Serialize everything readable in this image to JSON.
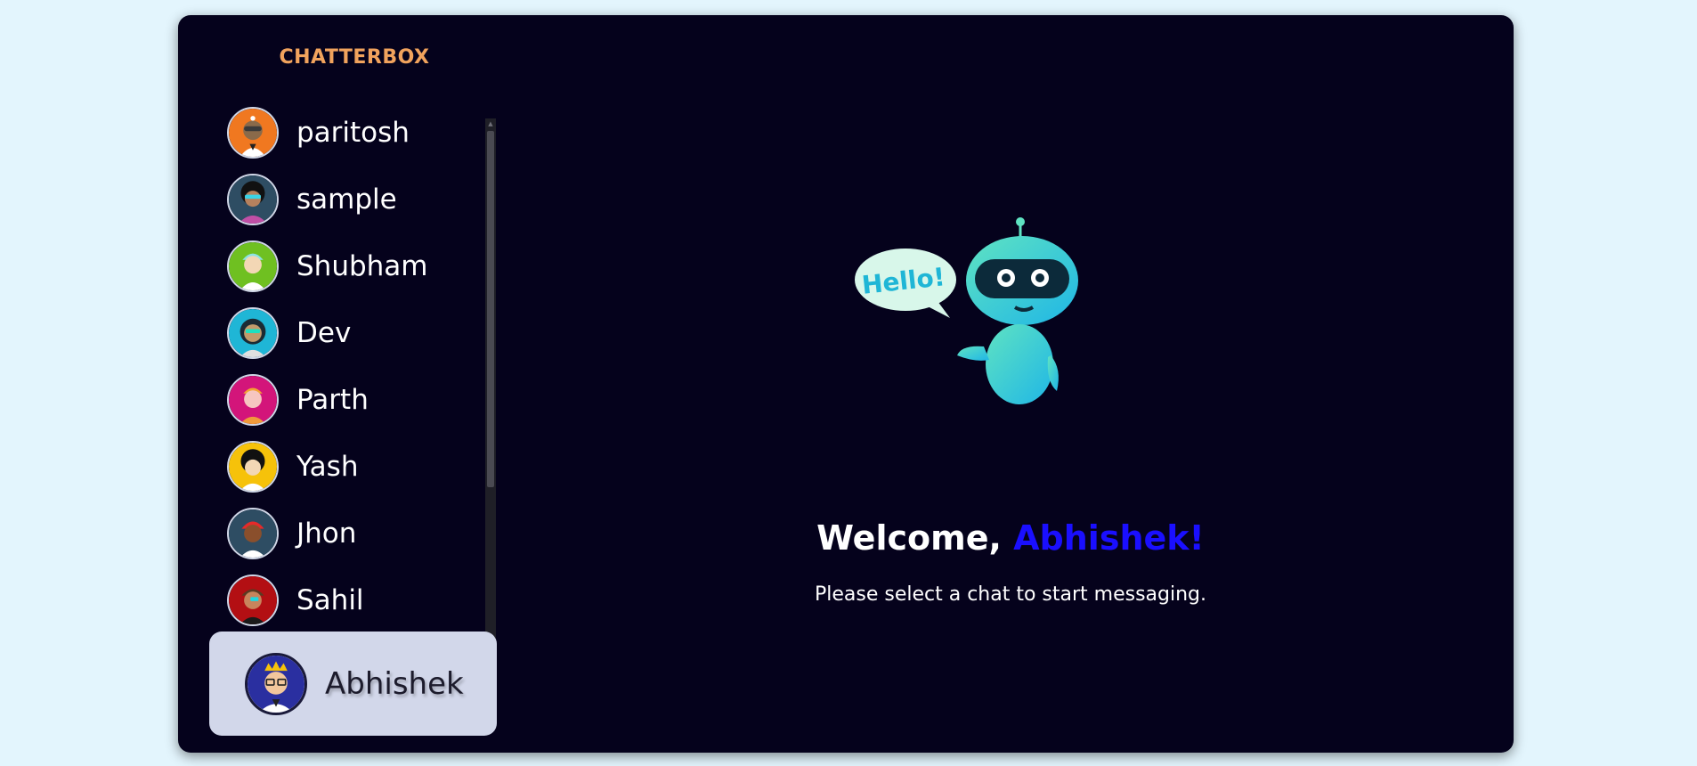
{
  "app": {
    "brand": "CHATTERBOX"
  },
  "contacts": [
    {
      "name": "paritosh",
      "avatar_bg": "#f07820"
    },
    {
      "name": "sample",
      "avatar_bg": "#2e4d63"
    },
    {
      "name": "Shubham",
      "avatar_bg": "#6fc021"
    },
    {
      "name": "Dev",
      "avatar_bg": "#1fb6d6"
    },
    {
      "name": "Parth",
      "avatar_bg": "#d3157a"
    },
    {
      "name": "Yash",
      "avatar_bg": "#f6c20a"
    },
    {
      "name": "Jhon",
      "avatar_bg": "#2e4d63"
    },
    {
      "name": "Sahil",
      "avatar_bg": "#b30f13"
    }
  ],
  "current_user": {
    "name": "Abhishek",
    "avatar_bg": "#2a2fa0"
  },
  "main": {
    "speech_bubble": "Hello!",
    "welcome_prefix": "Welcome, ",
    "welcome_name": "Abhishek!",
    "subtitle": "Please select a chat to start messaging."
  },
  "colors": {
    "page_bg": "#e3f5fd",
    "app_bg": "#05021c",
    "brand": "#f1a35d",
    "accent_name": "#1a0fff",
    "current_user_bg": "#d2d7ea"
  }
}
